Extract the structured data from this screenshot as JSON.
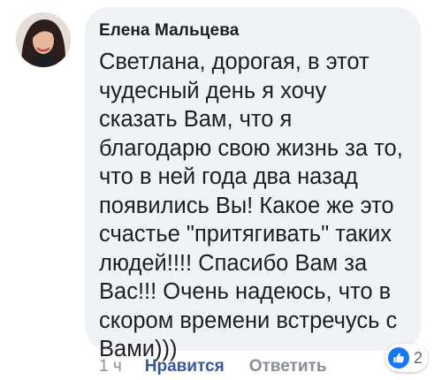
{
  "comment": {
    "author": "Елена Мальцева",
    "text": "Светлана, дорогая, в этот чудесный день я хочу сказать Вам, что я благодарю свою жизнь за то, что в ней года два назад появились Вы! Какое же это счастье \"притягивать\" таких людей!!!! Спасибо Вам за Вас!!! Очень надеюсь, что в скором времени встречусь с Вами)))"
  },
  "actions": {
    "timestamp": "1 ч",
    "like_label": "Нравится",
    "reply_label": "Ответить"
  },
  "reactions": {
    "icon": "thumbs-up-icon",
    "count": "2"
  },
  "colors": {
    "bubble_bg": "#f0f2f5",
    "link_blue": "#385898",
    "like_badge_blue": "#1877f2",
    "muted_text": "#8a8d91"
  }
}
